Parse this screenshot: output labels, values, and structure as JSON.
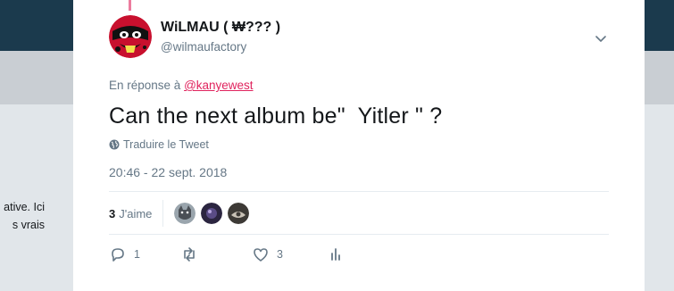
{
  "background": {
    "left_text_lines": [
      "ative. Ici",
      "s vrais"
    ]
  },
  "tweet": {
    "author_name": "WiLMAU ( ₩??? )",
    "author_handle": "@wilmaufactory",
    "reply_prefix": "En réponse à ",
    "reply_to_handle": "@kanyewest",
    "text": "Can the next album be\"  Yitler \" ?",
    "translate_label": "Traduire le Tweet",
    "timestamp": "20:46 - 22 sept. 2018",
    "likes_count": "3",
    "likes_label": "J'aime",
    "reply_count": "1",
    "retweet_count": "",
    "like_count": "3"
  },
  "colors": {
    "accent": "#e0245e",
    "secondary_text": "#657786",
    "card_bg": "#ffffff",
    "top_bar": "#1b3a4d"
  },
  "icons": {
    "menu": "chevron-down-icon",
    "translate": "globe-icon",
    "reply": "reply-icon",
    "retweet": "retweet-icon",
    "like": "heart-icon",
    "analytics": "bar-chart-icon"
  }
}
